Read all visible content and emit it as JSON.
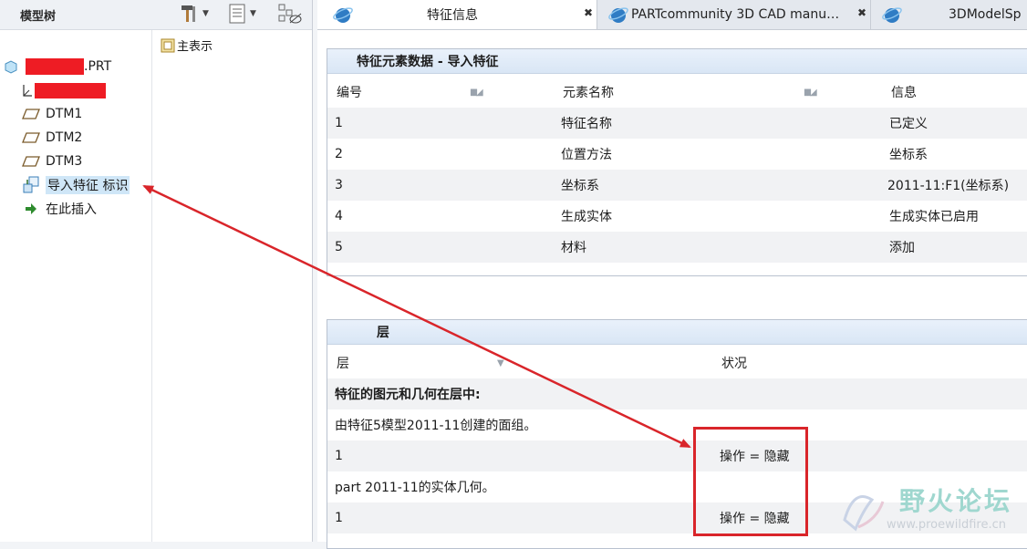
{
  "tree": {
    "title": "模型树",
    "column_header": "主表示",
    "root_suffix": ".PRT",
    "items": [
      {
        "label": "DTM1",
        "icon": "datum-plane-icon"
      },
      {
        "label": "DTM2",
        "icon": "datum-plane-icon"
      },
      {
        "label": "DTM3",
        "icon": "datum-plane-icon"
      },
      {
        "label": "导入特征 标识",
        "icon": "import-feature-icon"
      },
      {
        "label": "在此插入",
        "icon": "insert-here-arrow-icon"
      }
    ]
  },
  "tabs": [
    {
      "label": "特征信息",
      "active": true
    },
    {
      "label": "PARTcommunity 3D CAD manu…",
      "active": false
    },
    {
      "label": "3DModelSp",
      "active": false
    }
  ],
  "feature_panel": {
    "title": "特征元素数据 - 导入特征",
    "columns": [
      "编号",
      "元素名称",
      "信息"
    ],
    "rows": [
      [
        "1",
        "特征名称",
        "已定义"
      ],
      [
        "2",
        "位置方法",
        "坐标系"
      ],
      [
        "3",
        "坐标系",
        "2011-11:F1(坐标系)"
      ],
      [
        "4",
        "生成实体",
        "生成实体已启用"
      ],
      [
        "5",
        "材料",
        "添加"
      ]
    ]
  },
  "layer_panel": {
    "title": "层",
    "columns": [
      "层",
      "状况"
    ],
    "heading": "特征的图元和几何在层中:",
    "group1_label": "由特征5模型2011-11创建的面组。",
    "group1_layer": "1",
    "group1_status": "操作 = 隐藏",
    "group2_label": "part 2011-11的实体几何。",
    "group2_layer": "1",
    "group2_status": "操作 = 隐藏"
  },
  "watermark": {
    "title": "野火论坛",
    "url": "www.proewildfire.cn"
  },
  "colors": {
    "annotation_red": "#d9252a",
    "selection_blue": "#cfe6f7",
    "panel_header": "#dde8f5"
  }
}
